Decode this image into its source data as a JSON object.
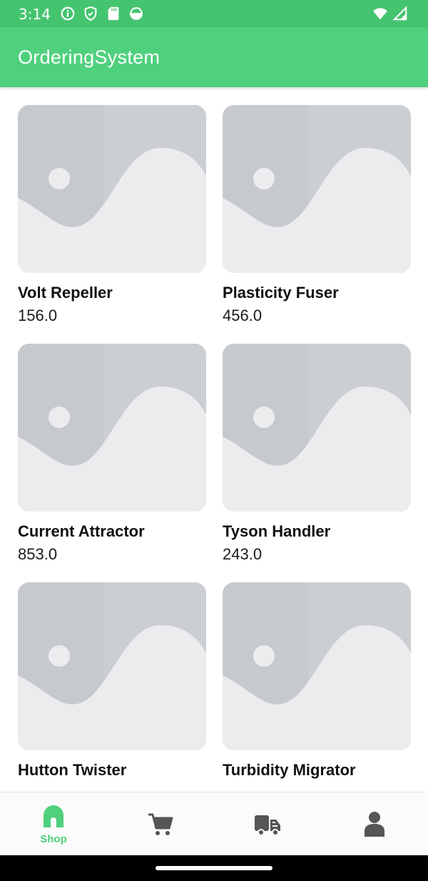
{
  "status_bar": {
    "time": "3:14",
    "icons": [
      "info-icon",
      "shield-icon",
      "sd-card-icon",
      "sync-icon"
    ],
    "right_icons": [
      "wifi-icon",
      "signal-icon"
    ]
  },
  "app_bar": {
    "title": "OrderingSystem"
  },
  "products": [
    {
      "name": "Volt Repeller",
      "price": "156.0"
    },
    {
      "name": "Plasticity Fuser",
      "price": "456.0"
    },
    {
      "name": "Current Attractor",
      "price": "853.0"
    },
    {
      "name": "Tyson Handler",
      "price": "243.0"
    },
    {
      "name": "Hutton Twister",
      "price": ""
    },
    {
      "name": "Turbidity Migrator",
      "price": ""
    }
  ],
  "bottom_nav": {
    "items": [
      {
        "label": "Shop",
        "icon": "shop-icon",
        "active": true
      },
      {
        "label": "",
        "icon": "cart-icon",
        "active": false
      },
      {
        "label": "",
        "icon": "delivery-truck-icon",
        "active": false
      },
      {
        "label": "",
        "icon": "profile-icon",
        "active": false
      }
    ]
  },
  "colors": {
    "primary": "#4fd07d",
    "status_bar": "#45c46f",
    "inactive_icon": "#555555",
    "placeholder": "#c6c9ce"
  }
}
